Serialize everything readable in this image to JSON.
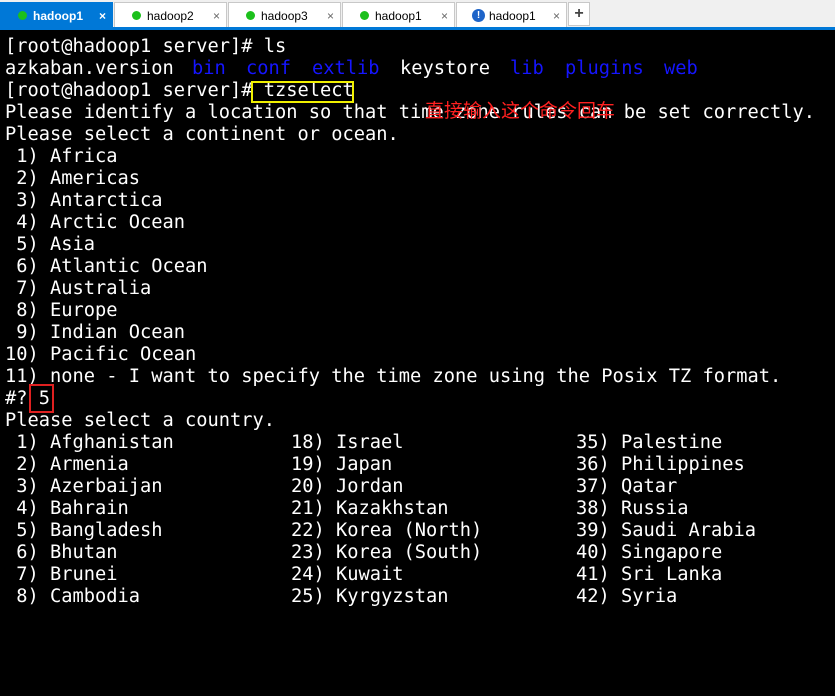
{
  "tabs": [
    {
      "label": "hadoop1",
      "close": "×"
    },
    {
      "label": "hadoop2",
      "close": "×"
    },
    {
      "label": "hadoop3",
      "close": "×"
    },
    {
      "label": "hadoop1",
      "close": "×"
    },
    {
      "label": "hadoop1",
      "close": "×",
      "icon": "!"
    }
  ],
  "new_tab": "+",
  "terminal": {
    "prompt1": "[root@hadoop1 server]# ls",
    "ls_output": {
      "file1": "azkaban.version",
      "dirs_a": [
        "bin",
        "conf",
        "extlib"
      ],
      "file2": "keystore",
      "dirs_b": [
        "lib",
        "plugins",
        "web"
      ]
    },
    "prompt2": "[root@hadoop1 server]# ",
    "command": "tzselect",
    "msg1": "Please identify a location so that time zone rules can be set correctly.",
    "msg2": "Please select a continent or ocean.",
    "continents": [
      " 1) Africa",
      " 2) Americas",
      " 3) Antarctica",
      " 4) Arctic Ocean",
      " 5) Asia",
      " 6) Atlantic Ocean",
      " 7) Australia",
      " 8) Europe",
      " 9) Indian Ocean",
      "10) Pacific Ocean",
      "11) none - I want to specify the time zone using the Posix TZ format."
    ],
    "input_prompt": "#? ",
    "input_value": "5",
    "msg3": "Please select a country.",
    "countries_col1": [
      " 1) Afghanistan",
      " 2) Armenia",
      " 3) Azerbaijan",
      " 4) Bahrain",
      " 5) Bangladesh",
      " 6) Bhutan",
      " 7) Brunei",
      " 8) Cambodia"
    ],
    "countries_col2": [
      "18) Israel",
      "19) Japan",
      "20) Jordan",
      "21) Kazakhstan",
      "22) Korea (North)",
      "23) Korea (South)",
      "24) Kuwait",
      "25) Kyrgyzstan"
    ],
    "countries_col3": [
      "35) Palestine",
      "36) Philippines",
      "37) Qatar",
      "38) Russia",
      "39) Saudi Arabia",
      "40) Singapore",
      "41) Sri Lanka",
      "42) Syria"
    ]
  },
  "annotation": "直接输入这个命令回车",
  "colors": {
    "directory": "#1515ff",
    "annotation": "#ff2020",
    "cmd_highlight": "#f0f000",
    "input_highlight": "#e02020",
    "tab_active": "#0078d7"
  }
}
